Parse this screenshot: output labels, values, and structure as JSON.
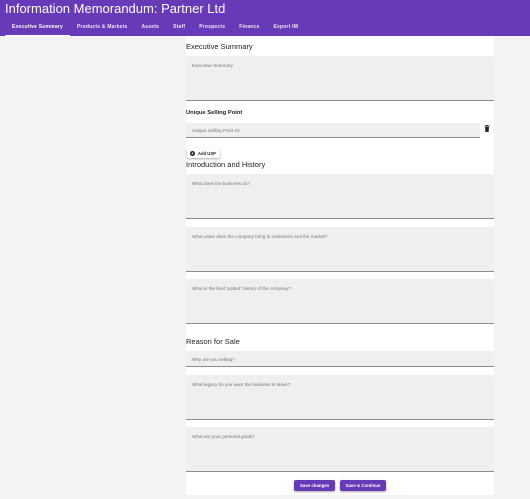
{
  "app": {
    "title": "Information Memorandum: Partner Ltd"
  },
  "tabs": [
    {
      "label": "Executive Summary",
      "active": true
    },
    {
      "label": "Products & Markets"
    },
    {
      "label": "Assets"
    },
    {
      "label": "Staff"
    },
    {
      "label": "Prospects"
    },
    {
      "label": "Finance"
    },
    {
      "label": "Export IM"
    }
  ],
  "executive_summary": {
    "title": "Executive Summary",
    "field_placeholder": "Executive Summary"
  },
  "usp": {
    "title": "Unique Selling Point",
    "items": [
      {
        "placeholder": "Unique Selling Point #1"
      }
    ],
    "add_label": "Add USP",
    "delete_icon": "trash-icon"
  },
  "introduction": {
    "title": "Introduction and History",
    "fields": [
      "What does the business do?",
      "What value does the company bring to customers and the market?",
      "What is the brief 'potted' history of the company?"
    ]
  },
  "reason_for_sale": {
    "title": "Reason for Sale",
    "fields": [
      "Why are you selling?",
      "What legacy do you want the business to leave?",
      "What are your personal goals?"
    ]
  },
  "actions": {
    "save_label": "Save changes",
    "save_continue_label": "Save & Continue"
  },
  "colors": {
    "primary": "#673ab7",
    "field_bg": "#efefef",
    "page_bg": "#f3f3f3"
  }
}
